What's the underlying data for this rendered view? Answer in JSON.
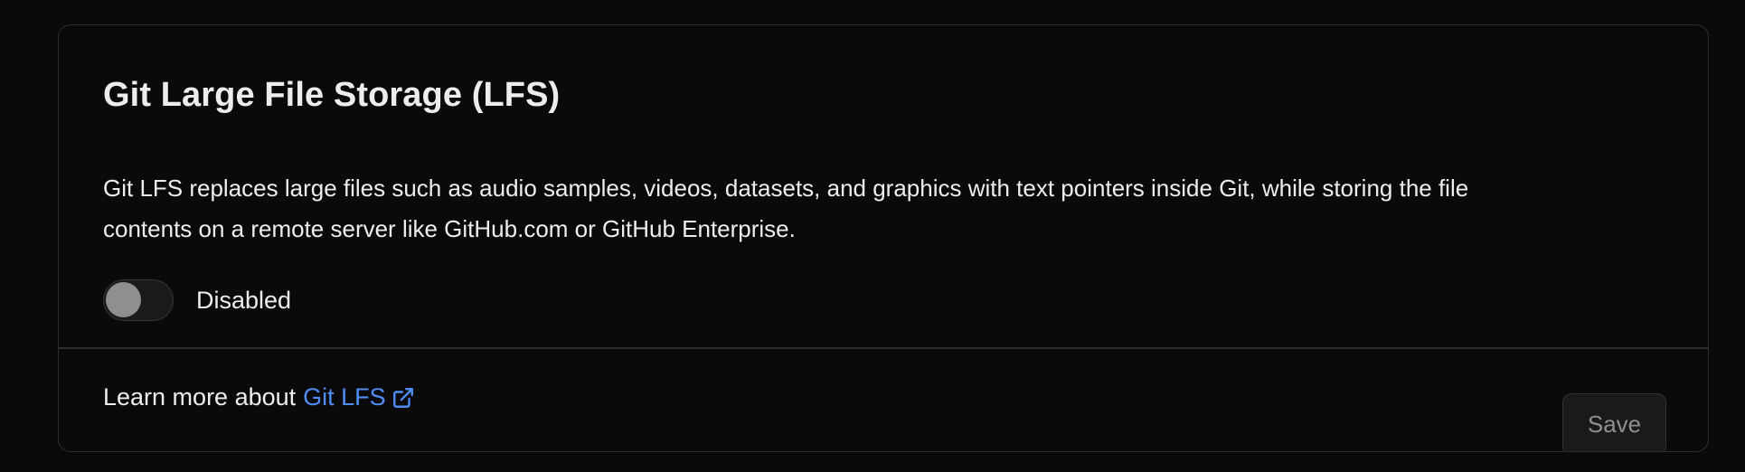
{
  "card": {
    "title": "Git Large File Storage (LFS)",
    "description_line1": "Git LFS replaces large files such as audio samples, videos, datasets, and graphics with text pointers inside Git, while storing the file",
    "description_line2": "contents on a remote server like GitHub.com or GitHub Enterprise.",
    "toggle": {
      "state": "off",
      "label": "Disabled"
    }
  },
  "footer": {
    "learn_more_prefix": "Learn more about",
    "learn_more_link": "Git LFS",
    "link_icon": "external-link-icon",
    "save_label": "Save",
    "save_disabled": true
  },
  "colors": {
    "background": "#0a0a0a",
    "border": "#2e2e2e",
    "text": "#ededed",
    "link": "#4f8df5",
    "muted": "#8f8f8f"
  }
}
